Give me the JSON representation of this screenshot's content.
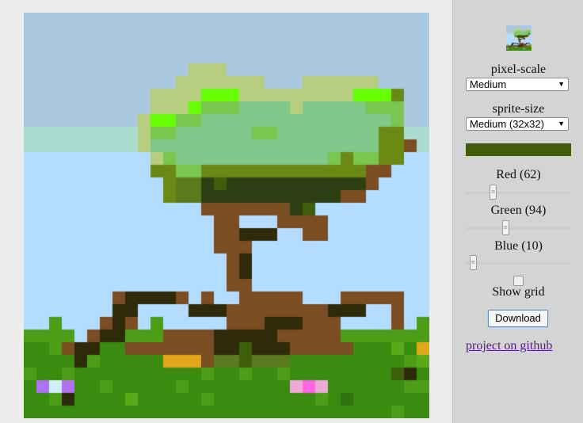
{
  "controls": {
    "pixel_scale_label": "pixel-scale",
    "pixel_scale_value": "Medium",
    "sprite_size_label": "sprite-size",
    "sprite_size_value": "Medium (32x32)",
    "color_hex": "#3e5e0a",
    "red_label": "Red (62)",
    "red_value": 62,
    "green_label": "Green (94)",
    "green_value": 94,
    "blue_label": "Blue (10)",
    "blue_value": 10,
    "grid_label": "Show grid",
    "grid_checked": false,
    "download_label": "Download",
    "github_link": "project on github"
  },
  "sprite": {
    "palette": {
      "a": "#b4dcff",
      "h": "#aac8e0",
      "b": "#aaddd0",
      "l": "#b8cd80",
      "G": "#7ac64f",
      "m": "#80c88a",
      "y": "#66ff00",
      "o": "#6a8a14",
      "O": "#5b7a1e",
      "d": "#2c4014",
      "D": "#3e5e0a",
      "t": "#7b4d22",
      "T": "#2e2a0a",
      "g": "#4b9e16",
      "r": "#3a8c10",
      "s": "#5aaa18",
      "R": "#2f7212",
      "Y": "#e2a61a",
      "E": "#e07c00",
      "P": "#b070f0",
      "W": "#d0f0ff",
      "k": "#f0a8d8",
      "K": "#ff66e6"
    },
    "rows": [
      "hhhhhhhhhhhhhhhhhhhhhhhhhhhhhhhh",
      "hhhhhhhhhhhhhhhhhhhhhhhhhhhhhhhh",
      "hhhhhhhhhhhhhhhhhhhhhhhhhhhhhhhh",
      "hhhhhhhhhhhhhhhhhhhhhhhhhhhhhhhh",
      "hhhhhhhhhhhhhlllhhhhhhhhhhhhhhhh",
      "hhhhhhhhhhhhlllllllhhhllllllhhhh",
      "hhhhhhhhhhllllyyylllllllllyyyohhh",
      "hhhhhhhhhhlllyGGGmmmmlmmmmmGGGhhh",
      "hhhhhhhhhlyyGGmmmmmmmmmmmmmmmGhhh",
      "bbbbbbbbblGGmmmmmmGGmmmmmmmmoobbb",
      "bbbbbbbbblmmmmmmmmmmmmmmmmmmootbb",
      "aaaaaaaaaalGmmmmmmmmmmmmGoGGooaaa",
      "aaaaaaaaaaooGGooooooooooooottaaaa",
      "aaaaaaaaaaaoOOdDdddddddddddtaaaaa",
      "aaaaaaaaaaaoOOdddddddddddttaaaaaa",
      "aaaaaaaaaaaaaatttttttdDaaaaaaaaaa",
      "aaaaaaaaaaaaaaattaaattttaaaaaaaaa",
      "aaaaaaaaaaaaaaattTTTaattaaaaaaaaa",
      "aaaaaaaaaaaaaaatttaaaaaaaaaaaaaaa",
      "aaaaaaaaaaaaaaaatTaaaaaaaaaaaaaaa",
      "aaaaaaaaaaaaaaaatTaaaaaaaaaaaaaaa",
      "aaaaaaaaaaaaaaaattaaaaaaaaaaaaaaa",
      "aaaaaaatTTTTtataatttttaaatttttaaa",
      "aaaaaaaTTaaaaTTTttttttttTTTaataaa",
      "aagaaatTtagaaaaatttTTTtttaaaatagaa",
      "ggggatTTgggttttTTTTTtttttggggggggg",
      "rrgtTTrrtttttttTTDTTTtttttrrrsrYEY",
      "rrrrTgrrrrrYYYtOODOOOrrrrrrrrrgsr",
      "grrgrrrrrrrrrrgrrgrrgrrrrrrrrDTrr",
      "rPWPrrgrrrrrgrrrrrrrrkKkrrrrrrggrr",
      "rrgTrrrrsrrrrrgrrrrrrrrgrRrrrrrrr",
      "rrrrrrrrrrrrrrrrrrrrrrrrrrrrrgrrr"
    ]
  }
}
